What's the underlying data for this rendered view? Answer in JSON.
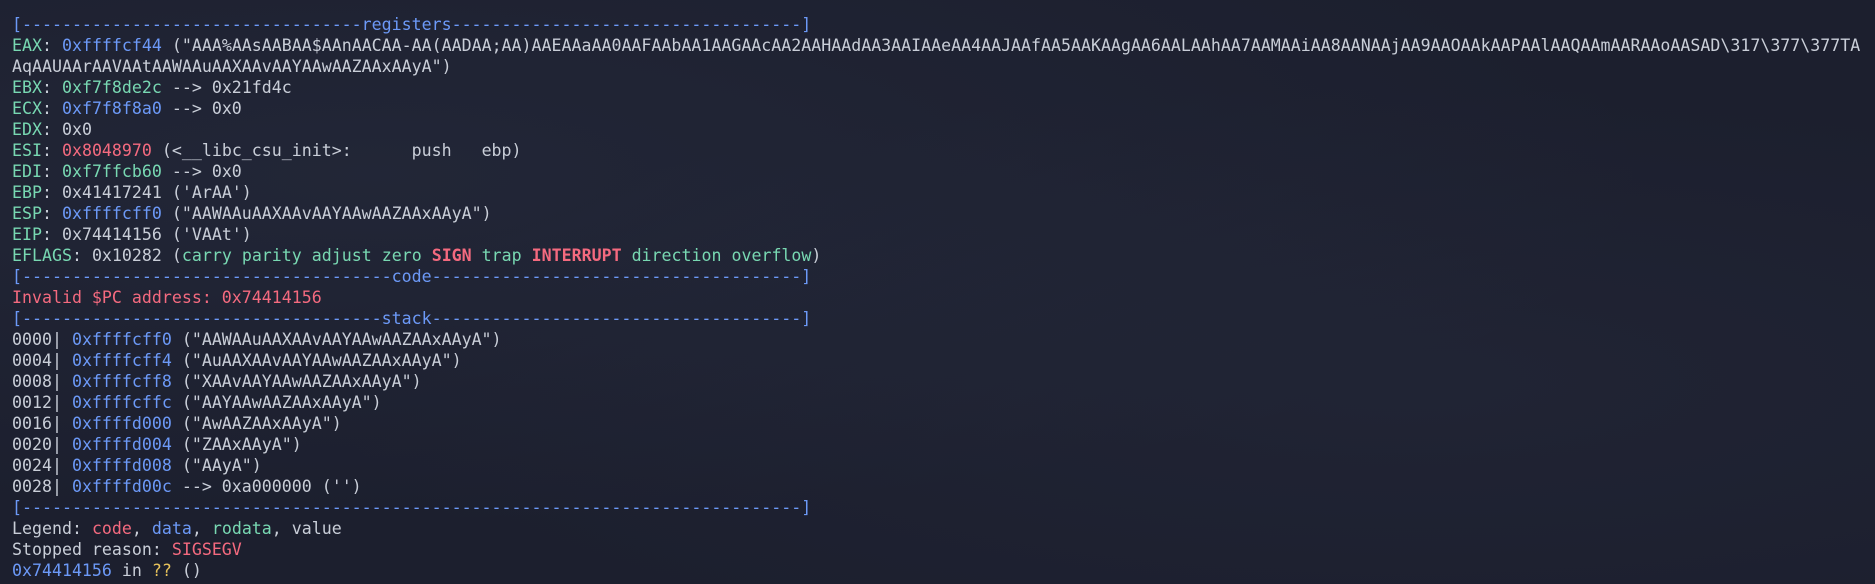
{
  "separators": {
    "registers": "[----------------------------------registers-----------------------------------]",
    "code": "[-------------------------------------code-------------------------------------]",
    "stack": "[------------------------------------stack-------------------------------------]",
    "end": "[------------------------------------------------------------------------------]"
  },
  "registers": {
    "eax": {
      "name": "EAX",
      "addr": "0xffffcf44",
      "str": "(\"AAA%AAsAABAA$AAnAACAA-AA(AADAA;AA)AAEAAaAA0AAFAAbAA1AAGAAcAA2AAHAAdAA3AAIAAeAA4AAJAAfAA5AAKAAgAA6AALAAhAA7AAMAAiAA8AANAAjAA9AAOAAkAAPAAlAAQAAmAARAAoAASAD\\317\\377\\377TAAqAAUAArAAVAAtAAWAAuAAXAAvAAYAAwAAZAAxAAyA\")"
    },
    "ebx": {
      "name": "EBX",
      "addr": "0xf7f8de2c",
      "rest": " --> 0x21fd4c"
    },
    "ecx": {
      "name": "ECX",
      "addr": "0xf7f8f8a0",
      "rest": " --> 0x0"
    },
    "edx": {
      "name": "EDX",
      "value": "0x0"
    },
    "esi": {
      "name": "ESI",
      "addr": "0x8048970",
      "rest": " (<__libc_csu_init>:      push   ebp)"
    },
    "edi": {
      "name": "EDI",
      "addr": "0xf7ffcb60",
      "rest": " --> 0x0"
    },
    "ebp": {
      "name": "EBP",
      "value": "0x41417241 ('ArAA')"
    },
    "esp": {
      "name": "ESP",
      "addr": "0xffffcff0",
      "rest": " (\"AAWAAuAAXAAvAAYAAwAAZAAxAAyA\")"
    },
    "eip": {
      "name": "EIP",
      "value": "0x74414156 ('VAAt')"
    },
    "eflags": {
      "name": "EFLAGS",
      "value": "0x10282",
      "open": "(",
      "carry": "carry",
      "parity": "parity",
      "adjust": "adjust",
      "zero": "zero",
      "sign": "SIGN",
      "trap": "trap",
      "interrupt": "INTERRUPT",
      "direction": "direction",
      "overflow": "overflow",
      "close": ")"
    }
  },
  "code": {
    "message": "Invalid $PC address: 0x74414156"
  },
  "stack": [
    {
      "offset": "0000|",
      "addr": "0xffffcff0",
      "rest": " (\"AAWAAuAAXAAvAAYAAwAAZAAxAAyA\")"
    },
    {
      "offset": "0004|",
      "addr": "0xffffcff4",
      "rest": " (\"AuAAXAAvAAYAAwAAZAAxAAyA\")"
    },
    {
      "offset": "0008|",
      "addr": "0xffffcff8",
      "rest": " (\"XAAvAAYAAwAAZAAxAAyA\")"
    },
    {
      "offset": "0012|",
      "addr": "0xffffcffc",
      "rest": " (\"AAYAAwAAZAAxAAyA\")"
    },
    {
      "offset": "0016|",
      "addr": "0xffffd000",
      "rest": " (\"AwAAZAAxAAyA\")"
    },
    {
      "offset": "0020|",
      "addr": "0xffffd004",
      "rest": " (\"ZAAxAAyA\")"
    },
    {
      "offset": "0024|",
      "addr": "0xffffd008",
      "rest": " (\"AAyA\")"
    },
    {
      "offset": "0028|",
      "addr": "0xffffd00c",
      "rest": " --> 0xa000000 ('')"
    }
  ],
  "legend": {
    "label": "Legend: ",
    "code": "code",
    "data": "data",
    "rodata": "rodata",
    "value": "value",
    "sep": ", "
  },
  "stopped": {
    "label": "Stopped reason: ",
    "reason": "SIGSEGV"
  },
  "location": {
    "addr": "0x74414156",
    "in": " in ",
    "func": "??",
    "args": " ()"
  },
  "colors": {
    "code": "#f46a7f",
    "data": "#6c99f7",
    "rodata": "#78d8b2",
    "value": "#c9ced8",
    "warn": "#e8c35b",
    "background": "#1c1f2e"
  }
}
